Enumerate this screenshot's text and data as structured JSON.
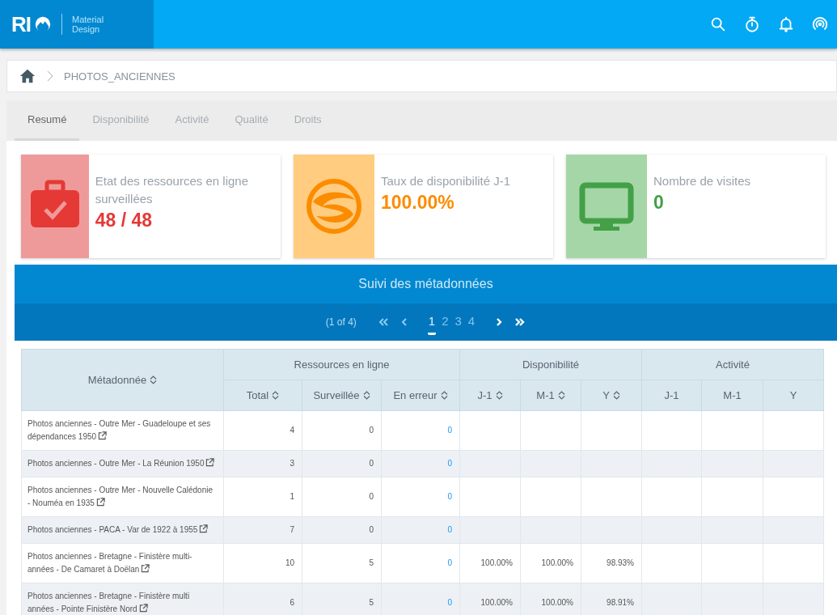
{
  "header": {
    "logo_text": "RI",
    "logo_subtitle": "Material Design"
  },
  "breadcrumb": {
    "items": [
      "PHOTOS_ANCIENNES"
    ]
  },
  "tabs": [
    {
      "label": "Resumé",
      "selected": true
    },
    {
      "label": "Disponibilité",
      "selected": false
    },
    {
      "label": "Activité",
      "selected": false
    },
    {
      "label": "Qualité",
      "selected": false
    },
    {
      "label": "Droits",
      "selected": false
    }
  ],
  "cards": [
    {
      "kind": "resources",
      "label": "Etat des ressources en ligne surveillées",
      "value": "48 / 48",
      "color": "#e53935"
    },
    {
      "kind": "availability",
      "label": "Taux de disponibilité J-1",
      "value": "100.00%",
      "color": "#fb8c00"
    },
    {
      "kind": "visits",
      "label": "Nombre de visites",
      "value": "0",
      "color": "#43a047"
    }
  ],
  "panel": {
    "title": "Suivi des métadonnées",
    "pager": {
      "info": "(1 of 4)",
      "pages": [
        {
          "label": "1",
          "selected": true
        },
        {
          "label": "2",
          "selected": false
        },
        {
          "label": "3",
          "selected": false
        },
        {
          "label": "4",
          "selected": false
        }
      ]
    }
  },
  "table": {
    "first_column": {
      "label": "Métadonnée",
      "sortable": true
    },
    "groups": [
      {
        "label": "Ressources en ligne",
        "columns": [
          {
            "label": "Total",
            "sortable": true
          },
          {
            "label": "Surveillée",
            "sortable": true
          },
          {
            "label": "En erreur",
            "sortable": true
          }
        ]
      },
      {
        "label": "Disponibilité",
        "columns": [
          {
            "label": "J-1",
            "sortable": true
          },
          {
            "label": "M-1",
            "sortable": true
          },
          {
            "label": "Y",
            "sortable": true
          }
        ]
      },
      {
        "label": "Activité",
        "columns": [
          {
            "label": "J-1",
            "sortable": false
          },
          {
            "label": "M-1",
            "sortable": false
          },
          {
            "label": "Y",
            "sortable": false
          }
        ]
      }
    ],
    "rows": [
      {
        "name": "Photos anciennes - Outre Mer - Guadeloupe et ses dépendances 1950",
        "cells": [
          "4",
          "0",
          "0",
          null,
          null,
          null,
          null,
          null,
          null
        ]
      },
      {
        "name": "Photos anciennes - Outre Mer - La Réunion 1950",
        "cells": [
          "3",
          "0",
          "0",
          null,
          null,
          null,
          null,
          null,
          null
        ]
      },
      {
        "name": "Photos anciennes - Outre Mer - Nouvelle Calédonie - Nouméa en 1935",
        "cells": [
          "1",
          "0",
          "0",
          null,
          null,
          null,
          null,
          null,
          null
        ]
      },
      {
        "name": "Photos anciennes - PACA - Var de 1922 à 1955",
        "cells": [
          "7",
          "0",
          "0",
          null,
          null,
          null,
          null,
          null,
          null
        ]
      },
      {
        "name": "Photos anciennes - Bretagne - Finistère multi-années - De Camaret à Doëlan",
        "cells": [
          "10",
          "5",
          "0",
          "100.00%",
          "100.00%",
          "98.93%",
          null,
          null,
          null
        ]
      },
      {
        "name": "Photos anciennes - Bretagne - Finistère multi années - Pointe Finistère Nord",
        "cells": [
          "6",
          "5",
          "0",
          "100.00%",
          "100.00%",
          "98.91%",
          null,
          null,
          null
        ]
      }
    ]
  }
}
